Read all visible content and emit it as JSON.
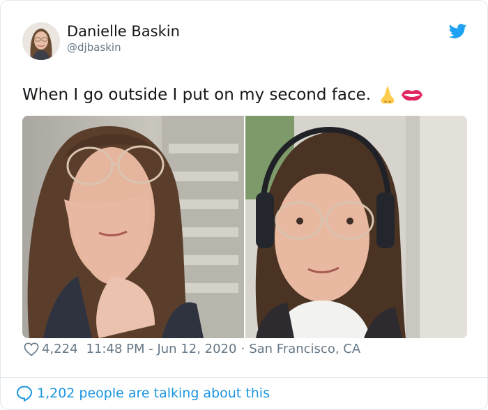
{
  "tweet": {
    "author_name": "Danielle Baskin",
    "author_handle": "@djbaskin",
    "text": "When I go outside I put on my second face.",
    "emojis": [
      "nose-emoji",
      "mouth-emoji"
    ],
    "likes": "4,224",
    "timestamp": "11:48 PM - Jun 12, 2020",
    "separator": "·",
    "location": "San Francisco, CA",
    "talking": "1,202 people are talking about this"
  },
  "colors": {
    "text": "#14171a",
    "muted": "#657786",
    "accent": "#1da1f2",
    "link": "#1b95e0",
    "border": "#e1e8ed"
  },
  "icons": {
    "brand": "twitter-bird-icon",
    "like": "heart-outline-icon",
    "replies": "speech-bubble-icon"
  }
}
